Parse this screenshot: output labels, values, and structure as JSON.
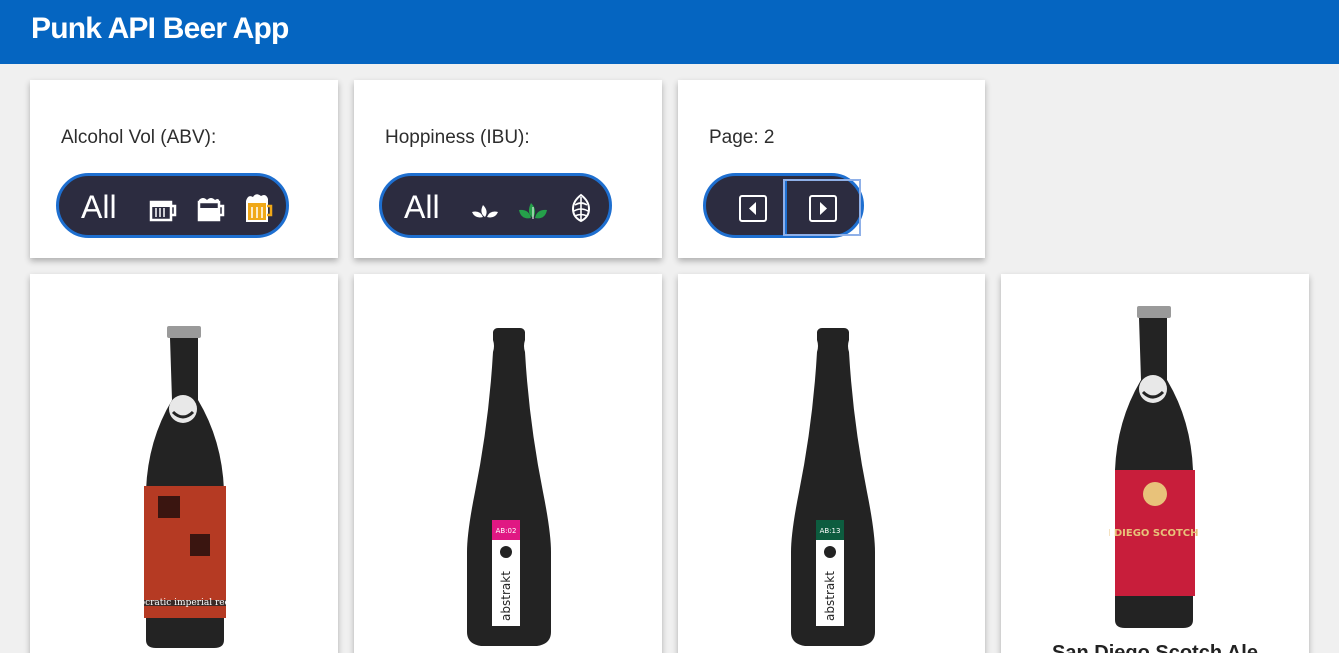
{
  "app": {
    "title": "Punk API Beer App"
  },
  "filters": {
    "abv": {
      "label": "Alcohol Vol (ABV):",
      "all_label": "All",
      "options": [
        "mug-small-icon",
        "mug-medium-icon",
        "mug-full-icon"
      ],
      "selected": "mug-full-icon",
      "accent": "#f0a818"
    },
    "ibu": {
      "label": "Hoppiness (IBU):",
      "all_label": "All",
      "options": [
        "hop-leaf-icon",
        "hop-leaves-icon",
        "hop-cone-icon"
      ],
      "selected": "hop-leaves-icon",
      "accent": "#25a04a"
    },
    "pagination": {
      "label": "Page: 2",
      "prev_icon": "caret-left-icon",
      "next_icon": "caret-right-icon"
    }
  },
  "beers": [
    {
      "name": "",
      "bottle": "brewdog-bottle",
      "label_color": "#b53a23",
      "label_text": "ocratic imperial red"
    },
    {
      "name": "",
      "bottle": "abstrakt-bottle",
      "label_color": "#e01883",
      "label_text": "AB:02"
    },
    {
      "name": "",
      "bottle": "abstrakt-bottle",
      "label_color": "#0d5c3f",
      "label_text": "AB:13"
    },
    {
      "name": "San Diego Scotch Ale",
      "bottle": "brewdog-bottle",
      "label_color": "#c81e3b",
      "label_text": "SAN DIEGO SCOTCH ALE"
    }
  ],
  "colors": {
    "header": "#0565c1",
    "pill_bg": "#2c2c40",
    "pill_border": "#1e6fd0"
  }
}
